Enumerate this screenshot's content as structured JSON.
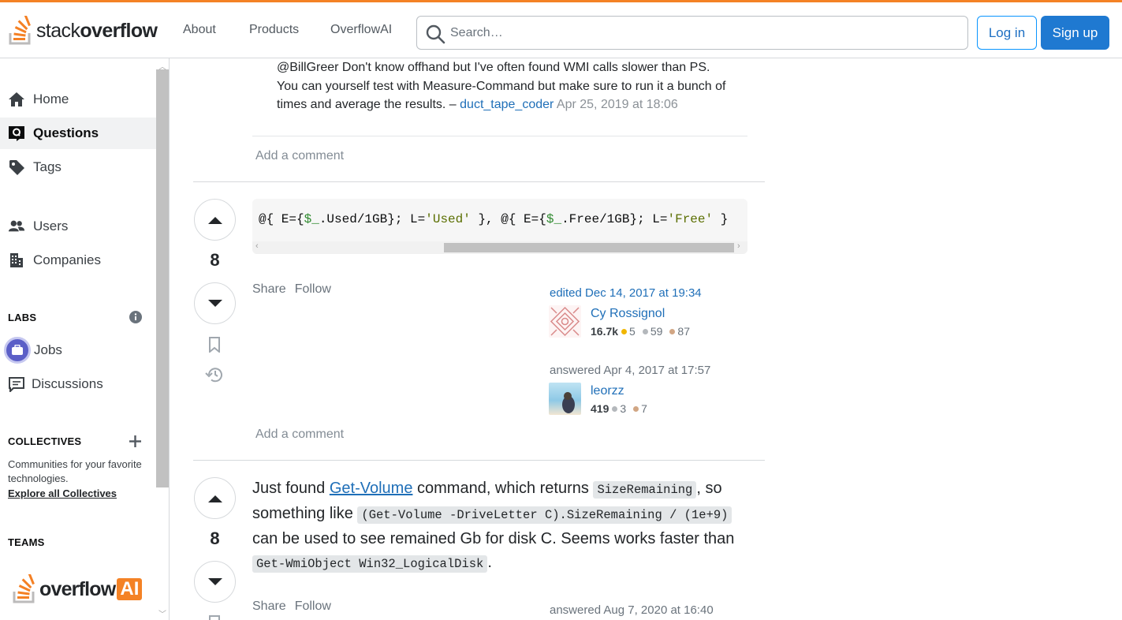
{
  "header": {
    "logo_stack": "stack",
    "logo_overflow": "overflow",
    "nav": [
      "About",
      "Products",
      "OverflowAI"
    ],
    "search_placeholder": "Search…",
    "login_label": "Log in",
    "signup_label": "Sign up",
    "accent_color": "#f48225"
  },
  "sidebar": {
    "items": [
      {
        "label": "Home",
        "icon": "home-icon"
      },
      {
        "label": "Questions",
        "icon": "questions-icon",
        "active": true
      },
      {
        "label": "Tags",
        "icon": "tag-icon"
      },
      {
        "label": "Users",
        "icon": "users-icon"
      },
      {
        "label": "Companies",
        "icon": "building-icon"
      }
    ],
    "labs_heading": "LABS",
    "labs_items": [
      {
        "label": "Jobs",
        "icon": "briefcase-icon"
      },
      {
        "label": "Discussions",
        "icon": "discussion-icon"
      }
    ],
    "collectives_heading": "COLLECTIVES",
    "collectives_text": "Communities for your favorite technologies.",
    "collectives_link": "Explore all Collectives",
    "teams_heading": "TEAMS",
    "overflowai_logo": "overflowAI"
  },
  "main": {
    "top_comment": {
      "text": "@BillGreer Don't know offhand but I've often found WMI calls slower than PS. You can yourself test with Measure-Command but make sure to run it a bunch of times and average the results. –",
      "user": "duct_tape_coder",
      "date": "Apr 25, 2019 at 18:06"
    },
    "add_comment_label": "Add a comment",
    "answer1": {
      "score": "8",
      "code": {
        "p1": "@{ E={",
        "v1": "$_",
        "p2": ".Used/1GB}; L=",
        "s1": "'Used'",
        "p3": " }, @{ E={",
        "v2": "$_",
        "p4": ".Free/1GB}; L=",
        "s2": "'Free'",
        "p5": " }"
      },
      "share_label": "Share",
      "follow_label": "Follow",
      "editor": {
        "action": "edited Dec 14, 2017 at 19:34",
        "name": "Cy Rossignol",
        "rep": "16.7k",
        "gold": "5",
        "silver": "59",
        "bronze": "87"
      },
      "author": {
        "action": "answered Apr 4, 2017 at 17:57",
        "name": "leorzz",
        "rep": "419",
        "silver": "3",
        "bronze": "7"
      }
    },
    "answer2": {
      "score": "8",
      "t1": "Just found ",
      "link": "Get-Volume",
      "t2": " command, which returns ",
      "c1": "SizeRemaining",
      "t3": ", so something like ",
      "c2": "(Get-Volume -DriveLetter C).SizeRemaining / (1e+9)",
      "t4": " can be used to see remained Gb for disk C. Seems works faster than ",
      "c3": "Get-WmiObject Win32_LogicalDisk",
      "t5": ".",
      "share_label": "Share",
      "follow_label": "Follow",
      "action": "answered Aug 7, 2020 at 16:40"
    }
  }
}
